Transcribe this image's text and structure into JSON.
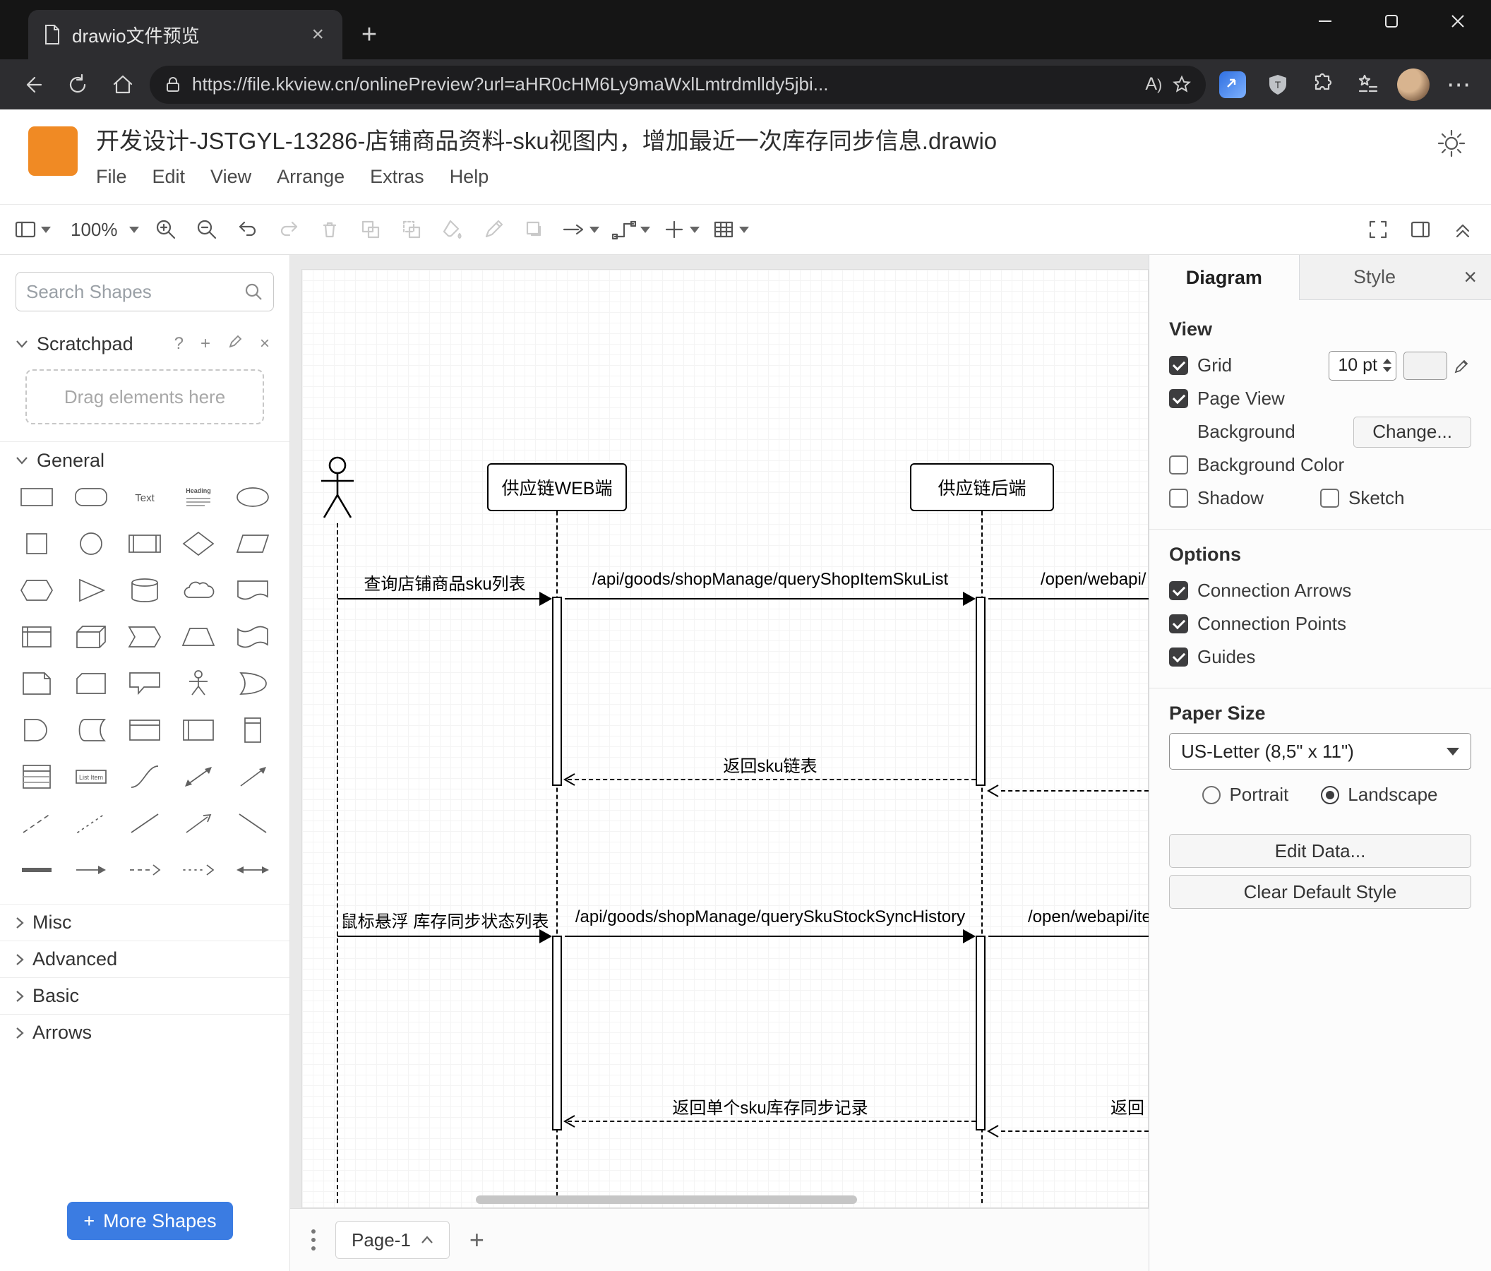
{
  "icons": {
    "close_glyph": "×",
    "plus_glyph": "+",
    "help_glyph": "?",
    "ellipsis_glyph": "⋯"
  },
  "colors": {
    "logo_orange": "#F08A24",
    "more_shapes_blue": "#3B7CE2",
    "tab_bg_dark": "#2d2d30"
  },
  "browser": {
    "tab_title": "drawio文件预览",
    "url": "https://file.kkview.cn/onlinePreview?url=aHR0cHM6Ly9maWxlLmtrdmlldy5jbi..."
  },
  "app": {
    "title": "开发设计-JSTGYL-13286-店铺商品资料-sku视图内，增加最近一次库存同步信息.drawio",
    "menu": [
      "File",
      "Edit",
      "View",
      "Arrange",
      "Extras",
      "Help"
    ]
  },
  "toolbar": {
    "zoom": "100%"
  },
  "sidebar": {
    "search_placeholder": "Search Shapes",
    "scratchpad_label": "Scratchpad",
    "drag_hint": "Drag elements here",
    "sections": [
      {
        "label": "General",
        "expanded": true
      },
      {
        "label": "Misc",
        "expanded": false
      },
      {
        "label": "Advanced",
        "expanded": false
      },
      {
        "label": "Basic",
        "expanded": false
      },
      {
        "label": "Arrows",
        "expanded": false
      }
    ],
    "palette": {
      "text": "Text",
      "heading": "Heading",
      "list_item": "List Item"
    },
    "more_shapes_label": "More Shapes"
  },
  "diagram": {
    "participants": [
      {
        "label": "供应链WEB端"
      },
      {
        "label": "供应链后端"
      }
    ],
    "messages": [
      {
        "label": "查询店铺商品sku列表",
        "type": "sync"
      },
      {
        "label": "/api/goods/shopManage/queryShopItemSkuList",
        "type": "sync"
      },
      {
        "label": "/open/webapi/",
        "type": "sync"
      },
      {
        "label": "返回sku链表",
        "type": "return"
      },
      {
        "label": "鼠标悬浮 库存同步状态列表",
        "type": "sync"
      },
      {
        "label": "/api/goods/shopManage/querySkuStockSyncHistory",
        "type": "sync"
      },
      {
        "label": "/open/webapi/item",
        "type": "sync"
      },
      {
        "label": "返回单个sku库存同步记录",
        "type": "return"
      },
      {
        "label": "返回",
        "type": "return"
      }
    ]
  },
  "pagebar": {
    "page_label": "Page-1"
  },
  "format_panel": {
    "tabs": [
      "Diagram",
      "Style"
    ],
    "view": {
      "heading": "View",
      "grid_label": "Grid",
      "grid_checked": true,
      "grid_size": "10 pt",
      "page_view_label": "Page View",
      "page_view_checked": true,
      "background_label": "Background",
      "change_button": "Change...",
      "background_color_label": "Background Color",
      "background_color_checked": false,
      "shadow_label": "Shadow",
      "shadow_checked": false,
      "sketch_label": "Sketch",
      "sketch_checked": false
    },
    "options": {
      "heading": "Options",
      "items": [
        {
          "label": "Connection Arrows",
          "checked": true
        },
        {
          "label": "Connection Points",
          "checked": true
        },
        {
          "label": "Guides",
          "checked": true
        }
      ]
    },
    "paper": {
      "heading": "Paper Size",
      "size_value": "US-Letter (8,5\" x 11\")",
      "portrait_label": "Portrait",
      "landscape_label": "Landscape",
      "orientation": "Landscape"
    },
    "buttons": {
      "edit_data": "Edit Data...",
      "clear_default_style": "Clear Default Style"
    }
  }
}
